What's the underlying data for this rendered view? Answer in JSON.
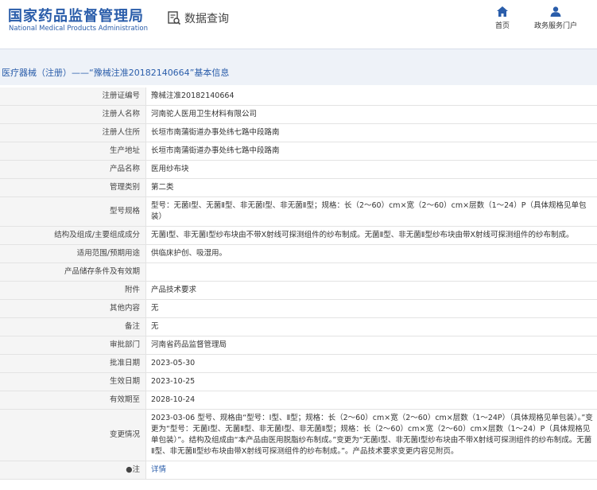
{
  "header": {
    "logo_cn": "国家药品监督管理局",
    "logo_en": "National Medical Products Administration",
    "search_label": "数据查询",
    "nav": [
      {
        "label": "首页",
        "icon": "home-icon"
      },
      {
        "label": "政务服务门户",
        "icon": "user-icon"
      }
    ]
  },
  "page_title": "医疗器械（注册）——“豫械注准20182140664”基本信息",
  "rows": [
    {
      "key": "注册证编号",
      "value": "豫械注准20182140664"
    },
    {
      "key": "注册人名称",
      "value": "河南驼人医用卫生材料有限公司"
    },
    {
      "key": "注册人住所",
      "value": "长垣市南蒲街道办事处纬七路中段路南"
    },
    {
      "key": "生产地址",
      "value": "长垣市南蒲街道办事处纬七路中段路南"
    },
    {
      "key": "产品名称",
      "value": "医用纱布块"
    },
    {
      "key": "管理类别",
      "value": "第二类"
    },
    {
      "key": "型号规格",
      "value": "型号：无菌Ⅰ型、无菌Ⅱ型、非无菌Ⅰ型、非无菌Ⅱ型；规格：长（2～60）cm×宽（2～60）cm×层数（1～24）P（具体规格见单包装）"
    },
    {
      "key": "结构及组成/主要组成成分",
      "value": "无菌Ⅰ型、非无菌Ⅰ型纱布块由不带X射线可探测组件的纱布制成。无菌Ⅱ型、非无菌Ⅱ型纱布块由带X射线可探测组件的纱布制成。"
    },
    {
      "key": "适用范围/预期用途",
      "value": "供临床护创、吸湿用。"
    },
    {
      "key": "产品储存条件及有效期",
      "value": ""
    },
    {
      "key": "附件",
      "value": "产品技术要求"
    },
    {
      "key": "其他内容",
      "value": "无"
    },
    {
      "key": "备注",
      "value": "无"
    },
    {
      "key": "审批部门",
      "value": "河南省药品监督管理局"
    },
    {
      "key": "批准日期",
      "value": "2023-05-30"
    },
    {
      "key": "生效日期",
      "value": "2023-10-25"
    },
    {
      "key": "有效期至",
      "value": "2028-10-24"
    },
    {
      "key": "变更情况",
      "value": "2023-03-06 型号、规格由“型号：Ⅰ型、Ⅱ型；规格：长（2～60）cm×宽（2～60）cm×层数（1～24P）（具体规格见单包装）。”变更为“型号：无菌Ⅰ型、无菌Ⅱ型、非无菌Ⅰ型、非无菌Ⅱ型；规格：长（2～60）cm×宽（2～60）cm×层数（1～24）P（具体规格见单包装）”。结构及组成由“本产品由医用脱脂纱布制成。”变更为“无菌Ⅰ型、非无菌Ⅰ型纱布块由不带X射线可探测组件的纱布制成。无菌Ⅱ型、非无菌Ⅱ型纱布块由带X射线可探测组件的纱布制成。”。产品技术要求变更内容见附页。"
    },
    {
      "key": "●注",
      "value": "详情",
      "link": true
    }
  ]
}
